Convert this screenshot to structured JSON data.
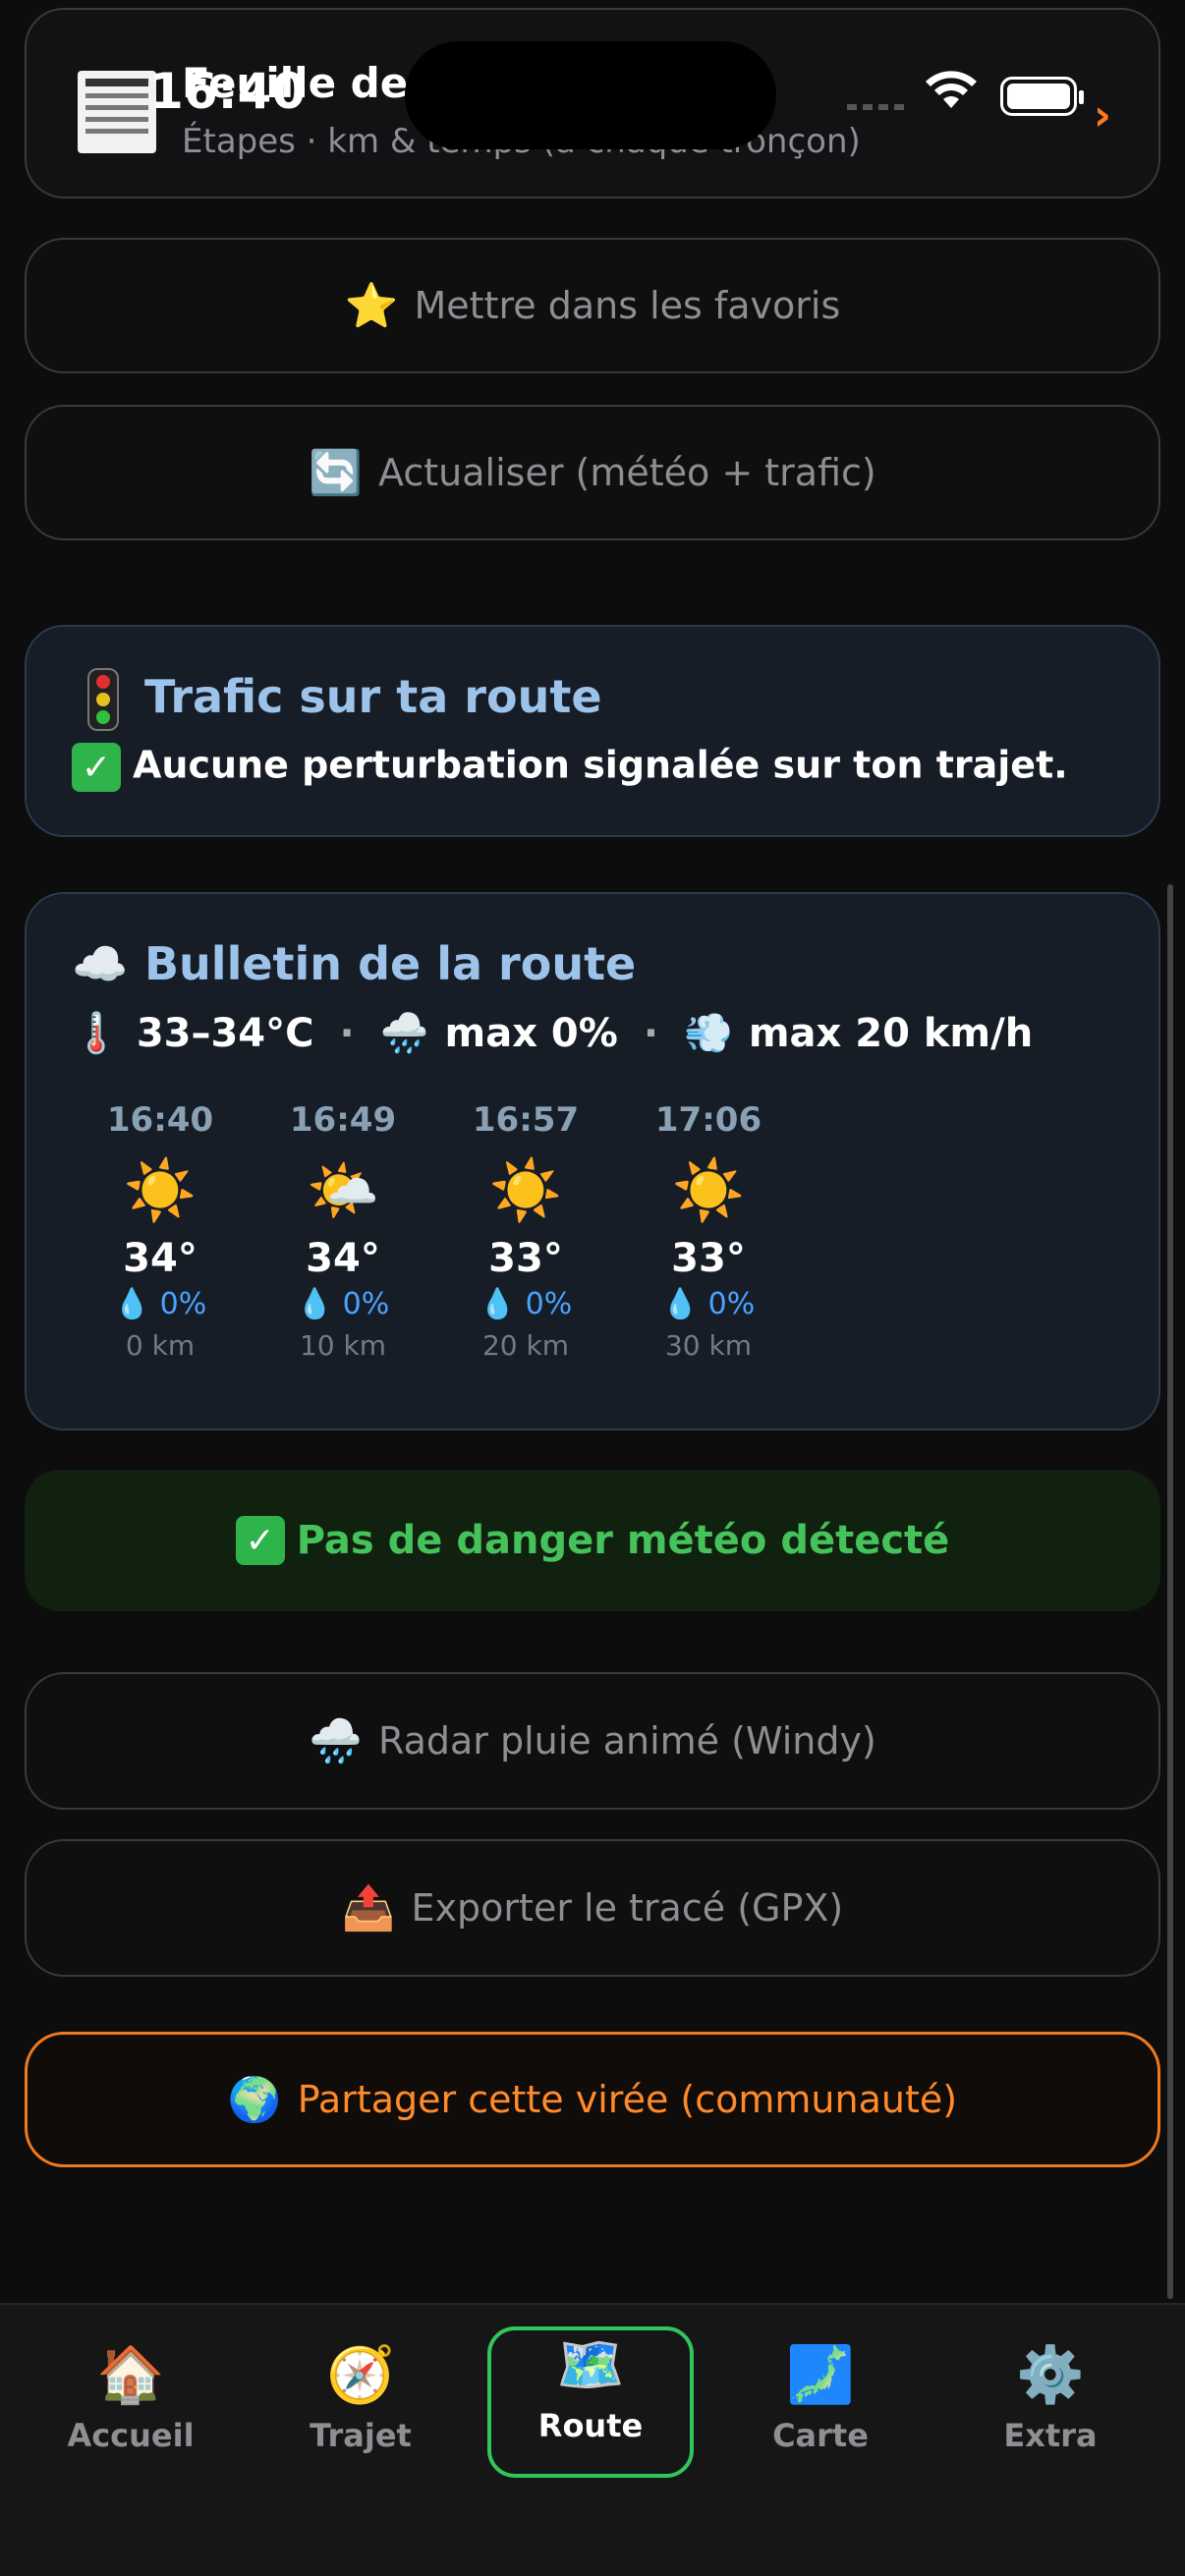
{
  "status": {
    "time": "16:40"
  },
  "top_card": {
    "title": "Feuille de r",
    "subtitle": "Étapes · km & temps (à chaque tronçon)"
  },
  "actions": {
    "favorite": {
      "emoji": "⭐",
      "label": "Mettre dans les favoris"
    },
    "refresh": {
      "emoji": "🔄",
      "label": "Actualiser (météo + trafic)"
    }
  },
  "traffic": {
    "title": "Trafic sur ta route",
    "message": "Aucune perturbation signalée sur ton trajet.",
    "check": "✓"
  },
  "weather": {
    "title_emoji": "☁️",
    "title": "Bulletin de la route",
    "temp_icon": "🌡️",
    "temp_range": "33–34°C",
    "sep": "·",
    "rain_icon": "🌧️",
    "rain_max": "max 0%",
    "wind_icon": "💨",
    "wind_max": "max 20 km/h",
    "slots": [
      {
        "time": "16:40",
        "icon": "☀️",
        "temp": "34°",
        "rain": "💧 0%",
        "dist": "0 km"
      },
      {
        "time": "16:49",
        "icon": "🌤️",
        "temp": "34°",
        "rain": "💧 0%",
        "dist": "10 km"
      },
      {
        "time": "16:57",
        "icon": "☀️",
        "temp": "33°",
        "rain": "💧 0%",
        "dist": "20 km"
      },
      {
        "time": "17:06",
        "icon": "☀️",
        "temp": "33°",
        "rain": "💧 0%",
        "dist": "30 km"
      }
    ]
  },
  "danger": {
    "check": "✓",
    "label": "Pas de danger météo détecté"
  },
  "radar": {
    "emoji": "🌧️",
    "label": "Radar pluie animé (Windy)"
  },
  "export": {
    "emoji": "📤",
    "label": "Exporter le tracé (GPX)"
  },
  "share": {
    "emoji": "🌍",
    "label": "Partager cette virée (communauté)"
  },
  "tabs": [
    {
      "icon": "🏠",
      "label": "Accueil"
    },
    {
      "icon": "🧭",
      "label": "Trajet"
    },
    {
      "icon": "🗺️",
      "label": "Route"
    },
    {
      "icon": "🗾",
      "label": "Carte"
    },
    {
      "icon": "⚙️",
      "label": "Extra"
    }
  ],
  "active_tab": "Route",
  "colors": {
    "accent_orange": "#ff8a2a",
    "accent_green": "#32c55a",
    "title_blue": "#9ec3ea"
  }
}
